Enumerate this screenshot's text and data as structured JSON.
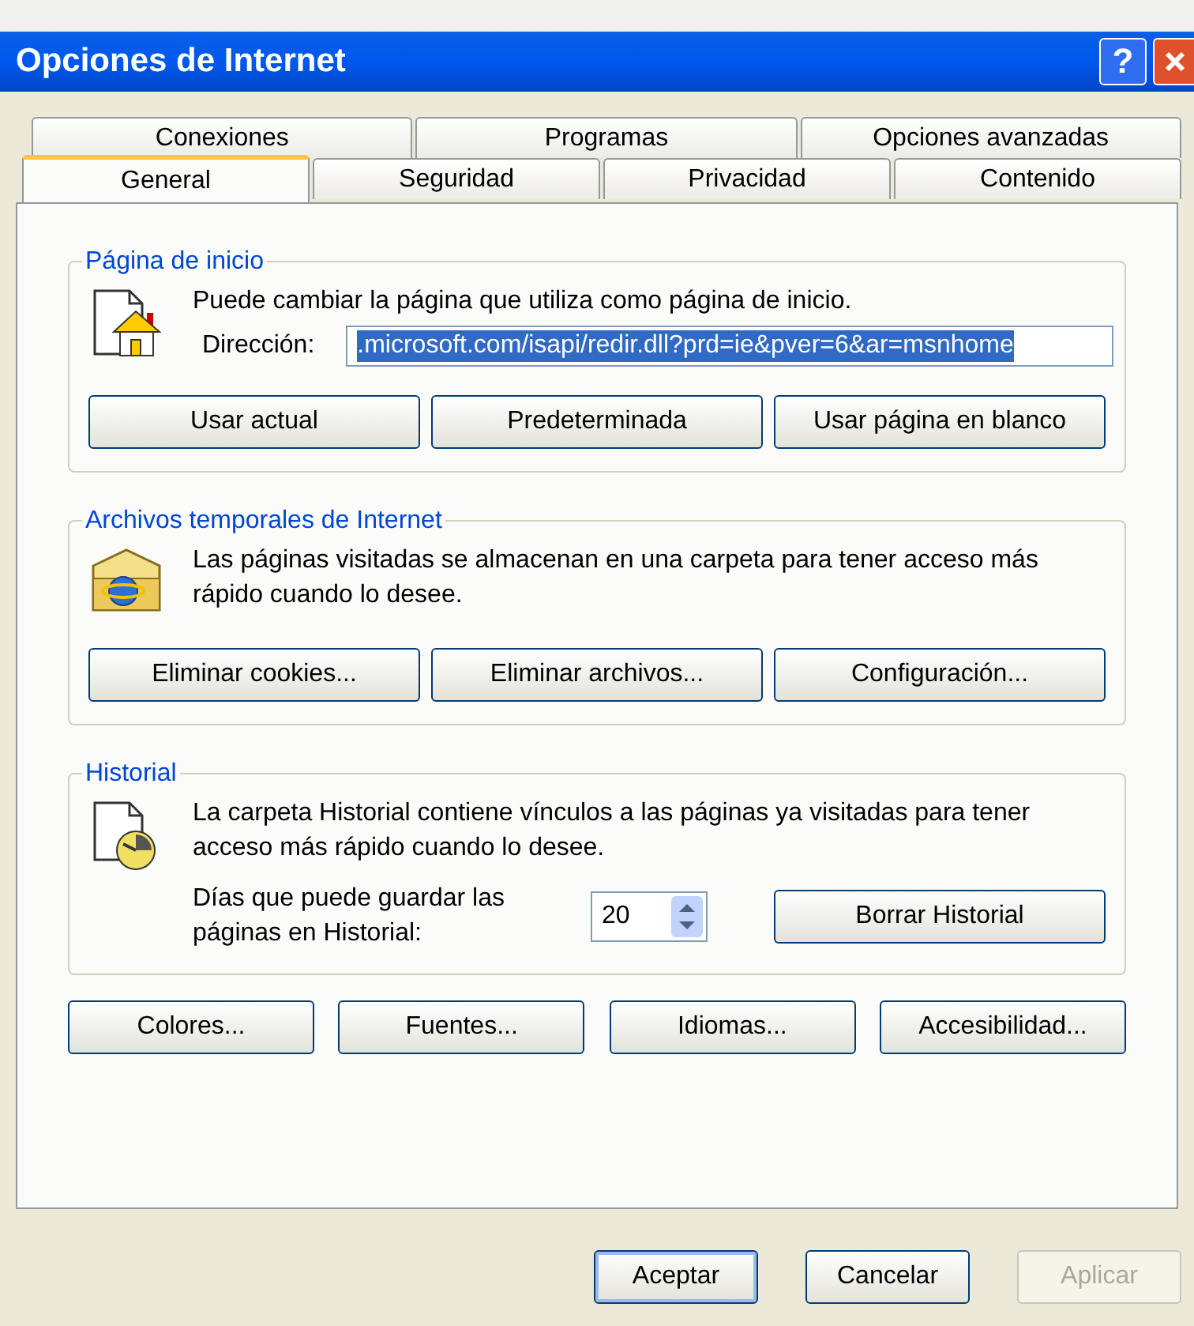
{
  "window": {
    "title": "Opciones de Internet",
    "help_label": "?"
  },
  "tabs": [
    [
      {
        "label": "Conexiones",
        "selected": false
      },
      {
        "label": "Programas",
        "selected": false
      },
      {
        "label": "Opciones avanzadas",
        "selected": false
      }
    ],
    [
      {
        "label": "General",
        "selected": true
      },
      {
        "label": "Seguridad",
        "selected": false
      },
      {
        "label": "Privacidad",
        "selected": false
      },
      {
        "label": "Contenido",
        "selected": false
      }
    ]
  ],
  "groups": [
    {
      "kind": "homepage",
      "title": "Página de inicio",
      "text": "Puede cambiar la página que utiliza como página de inicio.",
      "address": {
        "label": "Dirección:",
        "value": ".microsoft.com/isapi/redir.dll?prd=ie&pver=6&ar=msnhome",
        "highlighted": true
      },
      "buttons": [
        "Usar actual",
        "Predeterminada",
        "Usar página en blanco"
      ]
    },
    {
      "kind": "cache",
      "title": "Archivos temporales de Internet",
      "text": "Las páginas visitadas se almacenan en una carpeta para tener acceso más rápido cuando lo desee.",
      "buttons": [
        "Eliminar cookies...",
        "Eliminar archivos...",
        "Configuración..."
      ]
    },
    {
      "kind": "history",
      "title": "Historial",
      "text": "La carpeta Historial contiene vínculos a las páginas ya visitadas para tener acceso más rápido cuando lo desee.",
      "days": {
        "label": "Días que puede guardar las páginas en Historial:",
        "value": "20"
      },
      "buttons": [
        "Borrar Historial"
      ]
    }
  ],
  "extra_buttons": [
    "Colores...",
    "Fuentes...",
    "Idiomas...",
    "Accesibilidad..."
  ],
  "dialog_buttons": [
    {
      "label": "Aceptar",
      "default": true,
      "disabled": false
    },
    {
      "label": "Cancelar",
      "default": false,
      "disabled": false
    },
    {
      "label": "Aplicar",
      "default": false,
      "disabled": true
    }
  ]
}
